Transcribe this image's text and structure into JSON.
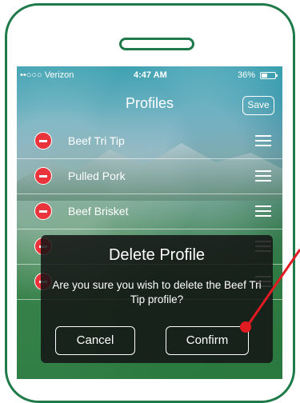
{
  "status_bar": {
    "carrier": "••○○○ Verizon",
    "time": "4:47 AM",
    "battery": "36%"
  },
  "nav": {
    "title": "Profiles",
    "save_label": "Save"
  },
  "profiles": [
    {
      "label": "Beef Tri Tip"
    },
    {
      "label": "Pulled Pork"
    },
    {
      "label": "Beef Brisket"
    },
    {
      "label": ""
    },
    {
      "label": ""
    }
  ],
  "dialog": {
    "title": "Delete Profile",
    "message": "Are you sure you wish to delete the Beef Tri Tip profile?",
    "cancel_label": "Cancel",
    "confirm_label": "Confirm"
  },
  "colors": {
    "phone_outline": "#1f7a4a",
    "delete_red": "#e8343a",
    "pointer_red": "#e11b22"
  }
}
